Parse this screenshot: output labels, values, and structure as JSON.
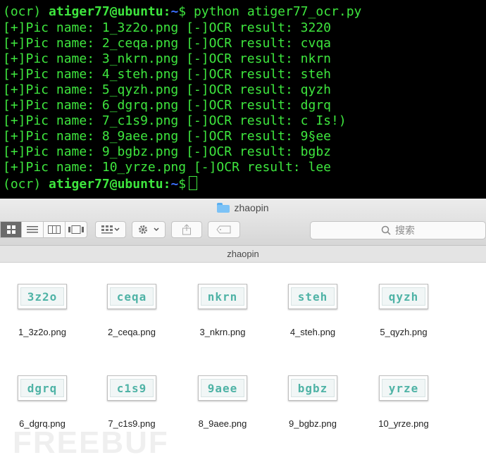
{
  "terminal": {
    "command_line": {
      "env": "(ocr) ",
      "user_host": "atiger77@ubuntu",
      "colon": ":",
      "path": "~",
      "symbol": "$ ",
      "command": "python atiger77_ocr.py"
    },
    "output": [
      "[+]Pic name: 1_3z2o.png [-]OCR result: 3220",
      "[+]Pic name: 2_ceqa.png [-]OCR result: cvqa",
      "[+]Pic name: 3_nkrn.png [-]OCR result: nkrn",
      "[+]Pic name: 4_steh.png [-]OCR result: steh",
      "[+]Pic name: 5_qyzh.png [-]OCR result: qyzh",
      "[+]Pic name: 6_dgrq.png [-]OCR result: dgrq",
      "[+]Pic name: 7_c1s9.png [-]OCR result: c Is!)",
      "[+]Pic name: 8_9aee.png [-]OCR result: 9§ee",
      "[+]Pic name: 9_bgbz.png [-]OCR result: bgbz",
      "[+]Pic name: 10_yrze.png [-]OCR result: lee"
    ],
    "final_prompt": {
      "env": "(ocr) ",
      "user_host": "atiger77@ubuntu",
      "colon": ":",
      "path": "~",
      "symbol": "$"
    },
    "colors": {
      "text": "#3ee63e",
      "path": "#3b6fff",
      "background": "#000000"
    }
  },
  "finder": {
    "window_title": "zhaopin",
    "path_bar_title": "zhaopin",
    "search_placeholder": "搜索",
    "files": [
      {
        "name": "1_3z2o.png",
        "captcha": "3z2o"
      },
      {
        "name": "2_ceqa.png",
        "captcha": "ceqa"
      },
      {
        "name": "3_nkrn.png",
        "captcha": "nkrn"
      },
      {
        "name": "4_steh.png",
        "captcha": "steh"
      },
      {
        "name": "5_qyzh.png",
        "captcha": "qyzh"
      },
      {
        "name": "6_dgrq.png",
        "captcha": "dgrq"
      },
      {
        "name": "7_c1s9.png",
        "captcha": "c1s9"
      },
      {
        "name": "8_9aee.png",
        "captcha": "9aee"
      },
      {
        "name": "9_bgbz.png",
        "captcha": "bgbz"
      },
      {
        "name": "10_yrze.png",
        "captcha": "yrze"
      }
    ],
    "captcha_color": "#4fb3a6"
  },
  "watermark": "FREEBUF"
}
